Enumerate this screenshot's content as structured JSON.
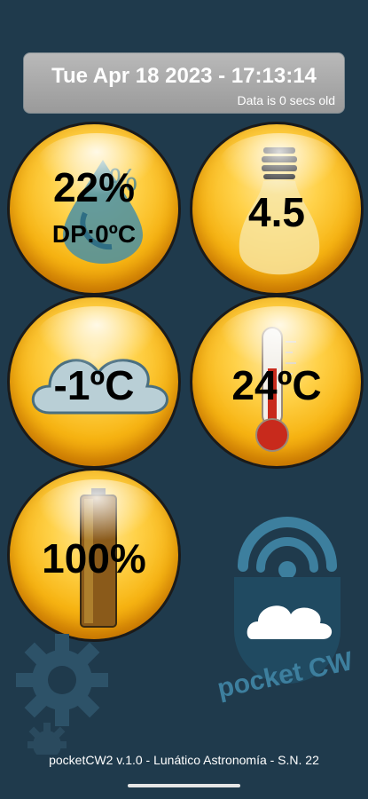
{
  "header": {
    "datetime": "Tue Apr 18 2023 - 17:13:14",
    "data_age": "Data is 0 secs old"
  },
  "tiles": {
    "humidity": {
      "value": "22%",
      "dewpoint": "DP:0ºC",
      "icon": "humidity-drop-icon"
    },
    "light": {
      "value": "4.5",
      "icon": "light-bulb-icon"
    },
    "sky": {
      "value": "-1ºC",
      "icon": "cloud-icon"
    },
    "temperature": {
      "value": "24ºC",
      "icon": "thermometer-icon"
    },
    "battery": {
      "value": "100%",
      "icon": "battery-icon"
    }
  },
  "logo": {
    "text": "pocket CW"
  },
  "footer": {
    "text": "pocketCW2 v.1.0 - Lunático Astronomía - S.N. 22"
  },
  "colors": {
    "background": "#1f3a4c",
    "orb": "#f7b412",
    "logo": "#3d7f9e"
  }
}
